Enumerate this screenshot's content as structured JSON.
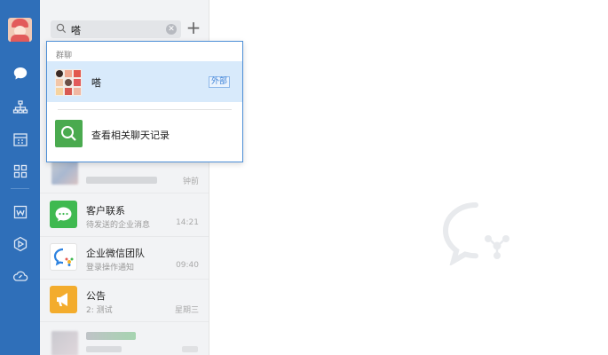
{
  "search": {
    "value": "嗒",
    "clear_glyph": "✕",
    "plus_glyph": "+"
  },
  "popup": {
    "section_label": "群聊",
    "group": {
      "name": "嗒",
      "tag": "外部"
    },
    "history_label": "查看相关聊天记录"
  },
  "chats": [
    {
      "title": "",
      "subtitle": "",
      "time": "钟前"
    },
    {
      "title": "客户联系",
      "subtitle": "待发送的企业消息",
      "time": "14:21"
    },
    {
      "title": "企业微信团队",
      "subtitle": "登录操作通知",
      "time": "09:40"
    },
    {
      "title": "公告",
      "subtitle": "2: 测试",
      "time": "星期三"
    }
  ],
  "colors": {
    "rail": "#2f6fb9",
    "accent_green": "#4aaa4f",
    "wechat_green": "#3fb950",
    "notice_orange": "#f3ac2d",
    "selected_row": "#d8eafb"
  },
  "icons": [
    "chat-icon",
    "contacts-icon",
    "calendar-icon",
    "apps-icon",
    "doc-icon",
    "drive-icon",
    "cloud-icon"
  ]
}
